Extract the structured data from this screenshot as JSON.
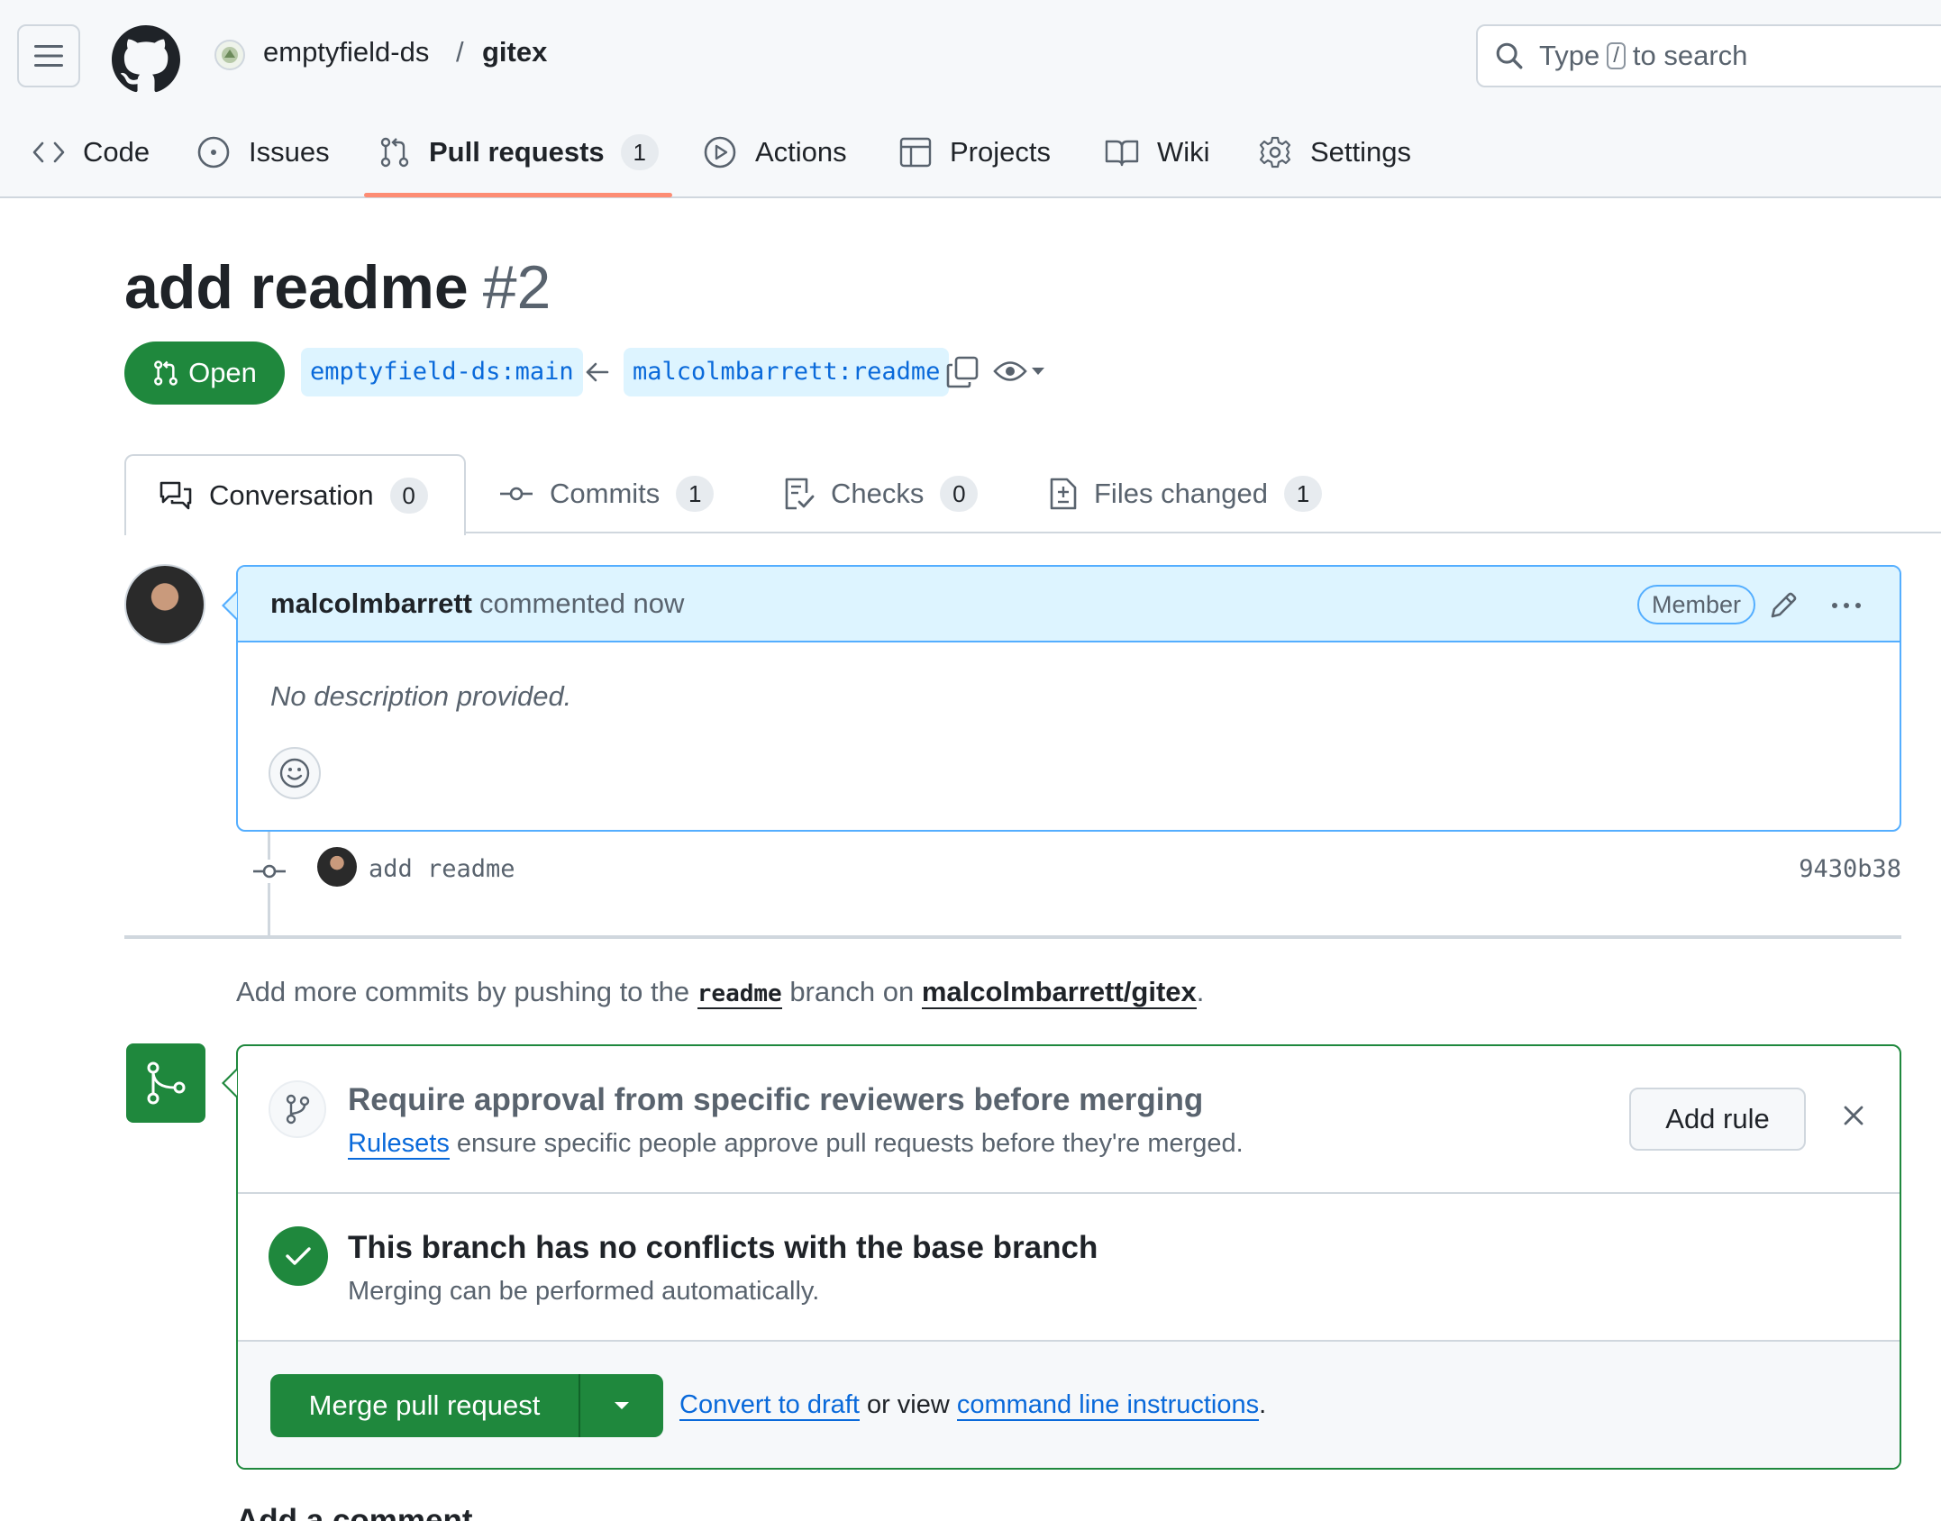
{
  "header": {
    "org": "emptyfield-ds",
    "separator": "/",
    "repo": "gitex",
    "search": {
      "prefix": "Type",
      "key": "/",
      "suffix": "to search"
    }
  },
  "nav": {
    "items": [
      {
        "label": "Code",
        "icon": "code-icon"
      },
      {
        "label": "Issues",
        "icon": "issue-icon"
      },
      {
        "label": "Pull requests",
        "icon": "pull-request-icon",
        "count": "1",
        "active": true
      },
      {
        "label": "Actions",
        "icon": "play-icon"
      },
      {
        "label": "Projects",
        "icon": "table-icon"
      },
      {
        "label": "Wiki",
        "icon": "book-icon"
      },
      {
        "label": "Settings",
        "icon": "gear-icon"
      }
    ]
  },
  "pr": {
    "title": "add readme",
    "number": "#2",
    "state": "Open",
    "base_branch": "emptyfield-ds:main",
    "head_branch": "malcolmbarrett:readme"
  },
  "tabs": [
    {
      "label": "Conversation",
      "count": "0",
      "active": true
    },
    {
      "label": "Commits",
      "count": "1"
    },
    {
      "label": "Checks",
      "count": "0"
    },
    {
      "label": "Files changed",
      "count": "1"
    }
  ],
  "comment": {
    "author": "malcolmbarrett",
    "action": "commented now",
    "role": "Member",
    "body": "No description provided."
  },
  "commit": {
    "message": "add readme",
    "sha": "9430b38"
  },
  "push_hint": {
    "before": "Add more commits by pushing to the",
    "branch": "readme",
    "middle": "branch on",
    "repo": "malcolmbarrett/gitex",
    "end": "."
  },
  "merge": {
    "rule_title": "Require approval from specific reviewers before merging",
    "rule_link": "Rulesets",
    "rule_sub": "ensure specific people approve pull requests before they're merged.",
    "add_rule": "Add rule",
    "status_title": "This branch has no conflicts with the base branch",
    "status_sub": "Merging can be performed automatically.",
    "merge_button": "Merge pull request",
    "convert_link": "Convert to draft",
    "or_view": "or view",
    "cli_link": "command line instructions",
    "period": "."
  },
  "add_comment_heading": "Add a comment",
  "colors": {
    "accent_green": "#1f883d",
    "link_blue": "#0969da",
    "active_tab_underline": "#fd8c73",
    "comment_header_bg": "#ddf4ff"
  }
}
